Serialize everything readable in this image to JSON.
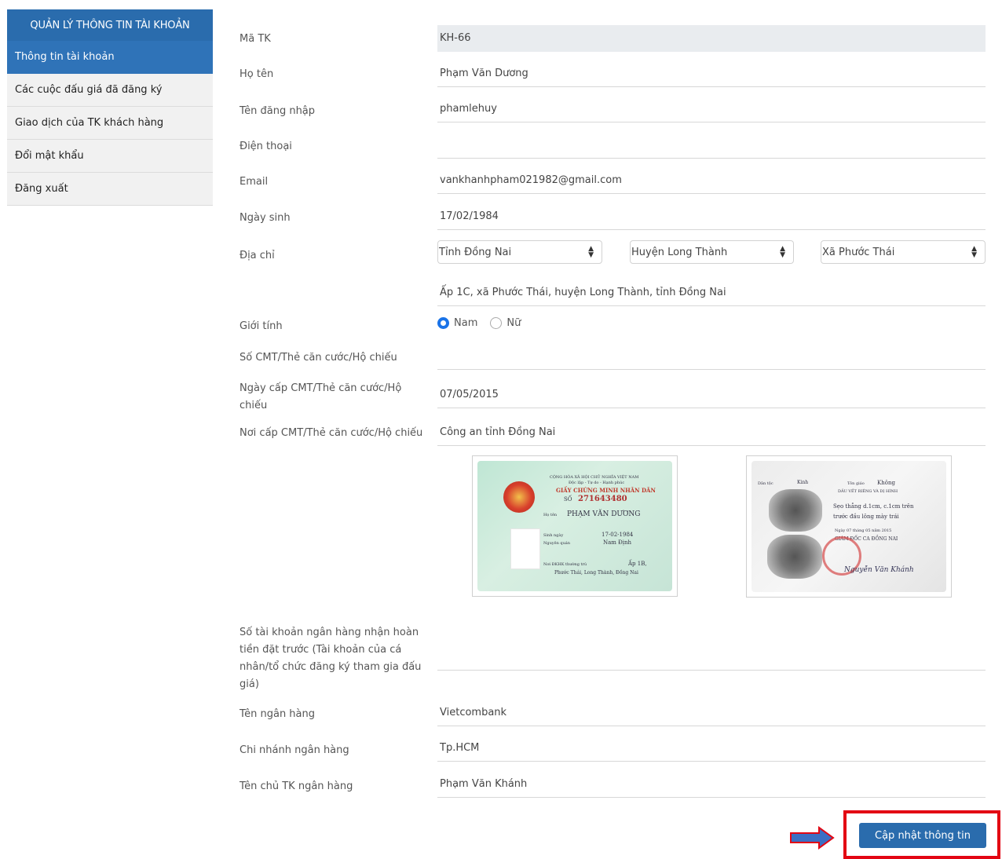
{
  "sidebar": {
    "header": "QUẢN LÝ THÔNG TIN TÀI KHOẢN",
    "items": [
      {
        "label": "Thông tin tài khoản",
        "active": true
      },
      {
        "label": "Các cuộc đấu giá đã đăng ký",
        "active": false
      },
      {
        "label": "Giao dịch của TK khách hàng",
        "active": false
      },
      {
        "label": "Đổi mật khẩu",
        "active": false
      },
      {
        "label": "Đăng xuất",
        "active": false
      }
    ]
  },
  "form": {
    "ma_tk": {
      "label": "Mã TK",
      "value": "KH-66"
    },
    "ho_ten": {
      "label": "Họ tên",
      "value": "Phạm Văn Dương"
    },
    "ten_dang_nhap": {
      "label": "Tên đăng nhập",
      "value": "phamlehuy"
    },
    "dien_thoai": {
      "label": "Điện thoại",
      "value": ""
    },
    "email": {
      "label": "Email",
      "value": "vankhanhpham021982@gmail.com"
    },
    "ngay_sinh": {
      "label": "Ngày sinh",
      "value": "17/02/1984"
    },
    "dia_chi": {
      "label": "Địa chỉ",
      "tinh": "Tỉnh Đồng Nai",
      "huyen": "Huyện Long Thành",
      "xa": "Xã Phước Thái",
      "chi_tiet": "Ấp 1C, xã Phước Thái, huyện Long Thành, tỉnh Đồng Nai"
    },
    "gioi_tinh": {
      "label": "Giới tính",
      "option_nam": "Nam",
      "option_nu": "Nữ",
      "selected": "Nam"
    },
    "so_cmt": {
      "label": "Số CMT/Thẻ căn cước/Hộ chiếu",
      "value": ""
    },
    "ngay_cap": {
      "label": "Ngày cấp CMT/Thẻ căn cước/Hộ chiếu",
      "value": "07/05/2015"
    },
    "noi_cap": {
      "label": "Nơi cấp CMT/Thẻ căn cước/Hộ chiếu",
      "value": "Công an tỉnh Đồng Nai"
    },
    "so_tai_khoan": {
      "label": "Số tài khoản ngân hàng nhận hoàn tiền đặt trước (Tài khoản của cá nhân/tổ chức đăng ký tham gia đấu giá)",
      "value": ""
    },
    "ten_ngan_hang": {
      "label": "Tên ngân hàng",
      "value": "Vietcombank"
    },
    "chi_nhanh": {
      "label": "Chi nhánh ngân hàng",
      "value": "Tp.HCM"
    },
    "ten_chu_tk": {
      "label": "Tên chủ TK ngân hàng",
      "value": "Phạm Văn Khánh"
    }
  },
  "id_card_front": {
    "line1": "CỘNG HÒA XÃ HỘI CHỦ NGHĨA VIỆT NAM",
    "line2": "Độc lập - Tự do - Hạnh phúc",
    "title": "GIẤY CHỨNG MINH NHÂN DÂN",
    "so_label": "SỐ",
    "so": "271643480",
    "hoten_label": "Họ tên",
    "hoten": "PHẠM VĂN DƯƠNG",
    "sinh_label": "Sinh ngày",
    "sinh": "17-02-1984",
    "quan_label": "Nguyên quán",
    "quan": "Nam Định",
    "tru_label": "Nơi ĐKHK thường trú",
    "tru1": "Ấp 1B,",
    "tru2": "Phước Thái, Long Thành, Đồng Nai"
  },
  "id_card_back": {
    "dantoc_label": "Dân tộc",
    "dantoc": "Kinh",
    "tongiao_label": "Tôn giáo",
    "tongiao": "Không",
    "dauvet": "DẤU VẾT RIÊNG VÀ DỊ HÌNH",
    "dv1": "Sẹo thẳng d.1cm, c.1cm trên",
    "dv2": "trước đầu lông mày trái",
    "ngay": "Ngày 07 tháng 05 năm 2015",
    "giamdoc": "GIÁM ĐỐC CA ĐỒNG NAI",
    "ky": "Nguyễn Văn Khánh"
  },
  "actions": {
    "update_label": "Cập nhật thông tin"
  }
}
